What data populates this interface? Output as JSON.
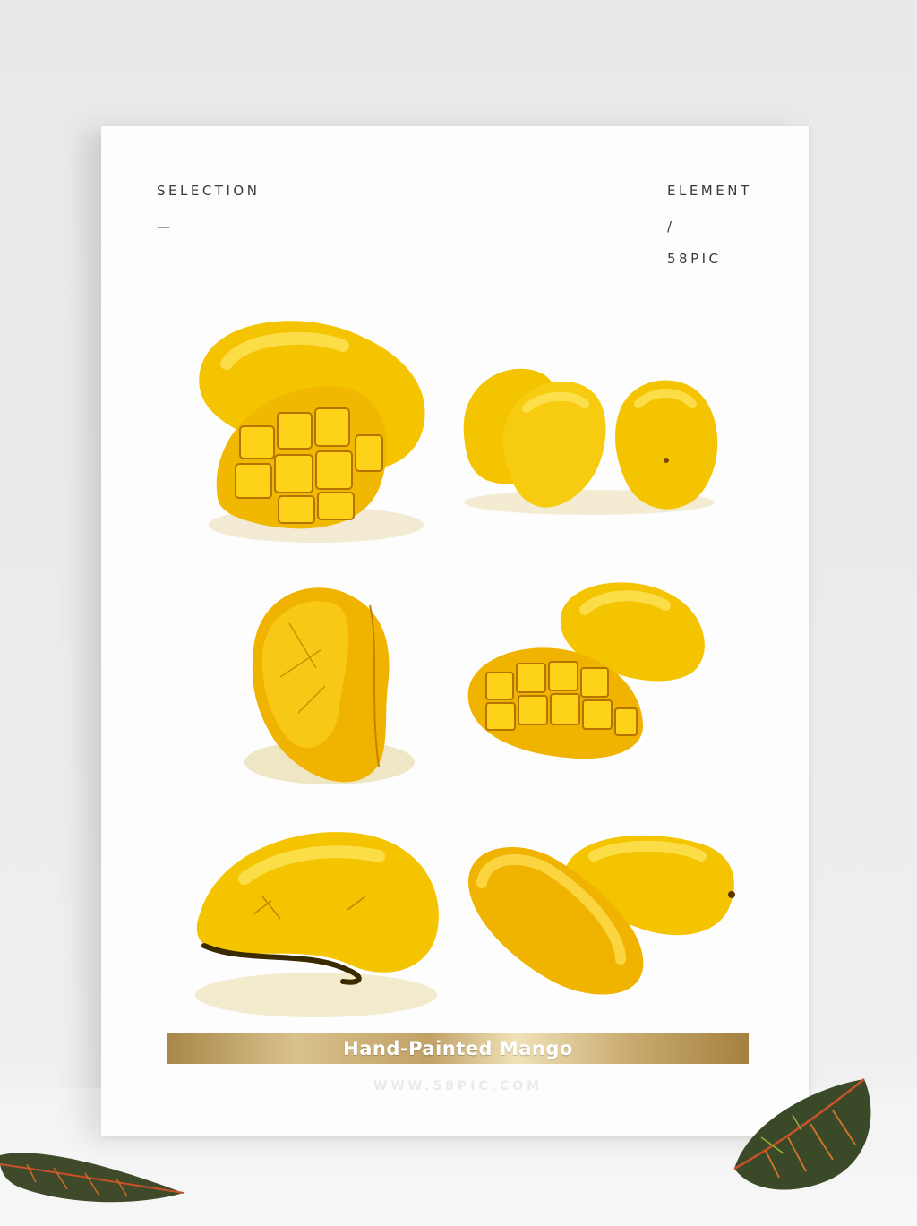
{
  "poster": {
    "top_left": {
      "line1": "SELECTION",
      "line2": "—"
    },
    "top_right": {
      "line1": "ELEMENT",
      "line2": "/",
      "line3": "58PIC"
    },
    "title": "Hand-Painted Mango",
    "website": "WWW.58PIC.COM",
    "mango_colors": {
      "main": "#f5c400",
      "light": "#fde35a",
      "shadow": "#d99a00",
      "edge": "#b57400"
    }
  }
}
